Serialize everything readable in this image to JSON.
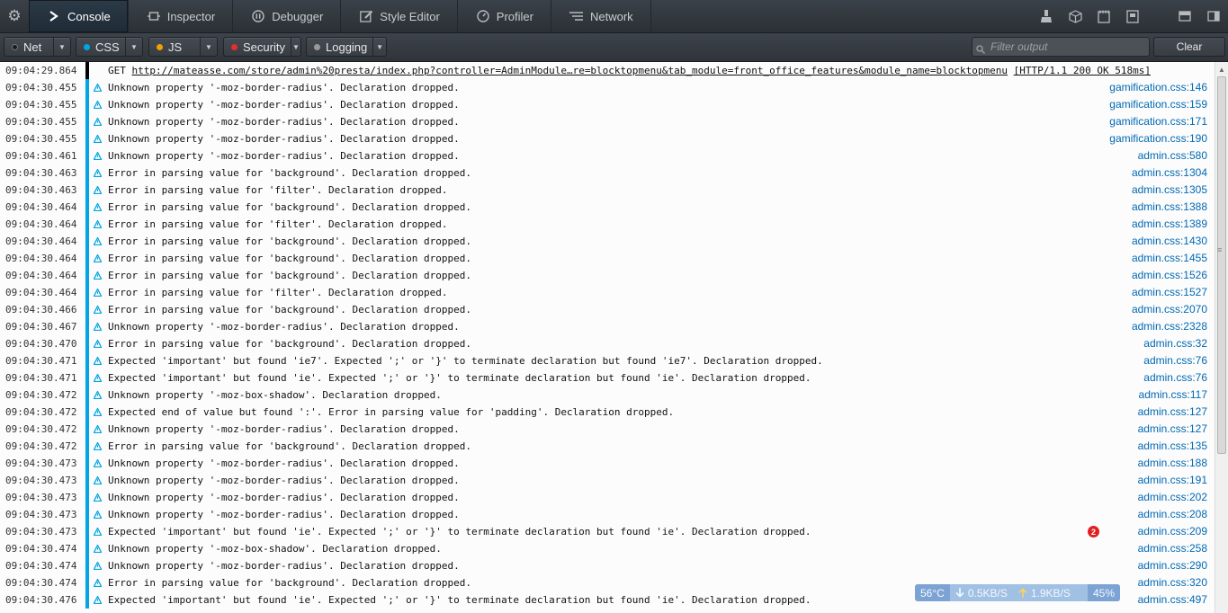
{
  "tabs": [
    {
      "label": "Console",
      "icon": "console-prompt-icon",
      "active": true
    },
    {
      "label": "Inspector",
      "icon": "inspector-icon",
      "active": false
    },
    {
      "label": "Debugger",
      "icon": "debugger-pause-icon",
      "active": false
    },
    {
      "label": "Style Editor",
      "icon": "pencil-icon",
      "active": false
    },
    {
      "label": "Profiler",
      "icon": "stopwatch-icon",
      "active": false
    },
    {
      "label": "Network",
      "icon": "network-icon",
      "active": false
    }
  ],
  "filters": [
    {
      "label": "Net",
      "color": "#1a1a1a"
    },
    {
      "label": "CSS",
      "color": "#00a6e3"
    },
    {
      "label": "JS",
      "color": "#f2a000"
    },
    {
      "label": "Security",
      "color": "#e03030"
    },
    {
      "label": "Logging",
      "color": "#999999"
    }
  ],
  "filter_output": {
    "placeholder": "Filter output",
    "value": ""
  },
  "clear_label": "Clear",
  "log": {
    "net_entry": {
      "time": "09:04:29.864",
      "method": "GET",
      "url": "http://mateasse.com/store/admin%20presta/index.php?controller=AdminModule…re=blocktopmenu&tab_module=front_office_features&module_name=blocktopmenu",
      "status": "[HTTP/1.1 200 OK 518ms]"
    },
    "entries": [
      {
        "time": "09:04:30.455",
        "msg": "Unknown property '-moz-border-radius'.  Declaration dropped.",
        "src": "gamification.css:146"
      },
      {
        "time": "09:04:30.455",
        "msg": "Unknown property '-moz-border-radius'.  Declaration dropped.",
        "src": "gamification.css:159"
      },
      {
        "time": "09:04:30.455",
        "msg": "Unknown property '-moz-border-radius'.  Declaration dropped.",
        "src": "gamification.css:171"
      },
      {
        "time": "09:04:30.455",
        "msg": "Unknown property '-moz-border-radius'.  Declaration dropped.",
        "src": "gamification.css:190"
      },
      {
        "time": "09:04:30.461",
        "msg": "Unknown property '-moz-border-radius'.  Declaration dropped.",
        "src": "admin.css:580"
      },
      {
        "time": "09:04:30.463",
        "msg": "Error in parsing value for 'background'.  Declaration dropped.",
        "src": "admin.css:1304"
      },
      {
        "time": "09:04:30.463",
        "msg": "Error in parsing value for 'filter'.  Declaration dropped.",
        "src": "admin.css:1305"
      },
      {
        "time": "09:04:30.464",
        "msg": "Error in parsing value for 'background'.  Declaration dropped.",
        "src": "admin.css:1388"
      },
      {
        "time": "09:04:30.464",
        "msg": "Error in parsing value for 'filter'.  Declaration dropped.",
        "src": "admin.css:1389"
      },
      {
        "time": "09:04:30.464",
        "msg": "Error in parsing value for 'background'.  Declaration dropped.",
        "src": "admin.css:1430"
      },
      {
        "time": "09:04:30.464",
        "msg": "Error in parsing value for 'background'.  Declaration dropped.",
        "src": "admin.css:1455"
      },
      {
        "time": "09:04:30.464",
        "msg": "Error in parsing value for 'background'.  Declaration dropped.",
        "src": "admin.css:1526"
      },
      {
        "time": "09:04:30.464",
        "msg": "Error in parsing value for 'filter'.  Declaration dropped.",
        "src": "admin.css:1527"
      },
      {
        "time": "09:04:30.466",
        "msg": "Error in parsing value for 'background'.  Declaration dropped.",
        "src": "admin.css:2070"
      },
      {
        "time": "09:04:30.467",
        "msg": "Unknown property '-moz-border-radius'.  Declaration dropped.",
        "src": "admin.css:2328"
      },
      {
        "time": "09:04:30.470",
        "msg": "Error in parsing value for 'background'.  Declaration dropped.",
        "src": "admin.css:32"
      },
      {
        "time": "09:04:30.471",
        "msg": "Expected 'important' but found 'ie7'.  Expected ';' or '}' to terminate declaration but found 'ie7'.  Declaration dropped.",
        "src": "admin.css:76"
      },
      {
        "time": "09:04:30.471",
        "msg": "Expected 'important' but found 'ie'.  Expected ';' or '}' to terminate declaration but found 'ie'.  Declaration dropped.",
        "src": "admin.css:76"
      },
      {
        "time": "09:04:30.472",
        "msg": "Unknown property '-moz-box-shadow'.  Declaration dropped.",
        "src": "admin.css:117"
      },
      {
        "time": "09:04:30.472",
        "msg": "Expected end of value but found ':'.  Error in parsing value for 'padding'.  Declaration dropped.",
        "src": "admin.css:127"
      },
      {
        "time": "09:04:30.472",
        "msg": "Unknown property '-moz-border-radius'.  Declaration dropped.",
        "src": "admin.css:127"
      },
      {
        "time": "09:04:30.472",
        "msg": "Error in parsing value for 'background'.  Declaration dropped.",
        "src": "admin.css:135"
      },
      {
        "time": "09:04:30.473",
        "msg": "Unknown property '-moz-border-radius'.  Declaration dropped.",
        "src": "admin.css:188"
      },
      {
        "time": "09:04:30.473",
        "msg": "Unknown property '-moz-border-radius'.  Declaration dropped.",
        "src": "admin.css:191"
      },
      {
        "time": "09:04:30.473",
        "msg": "Unknown property '-moz-border-radius'.  Declaration dropped.",
        "src": "admin.css:202"
      },
      {
        "time": "09:04:30.473",
        "msg": "Unknown property '-moz-border-radius'.  Declaration dropped.",
        "src": "admin.css:208"
      },
      {
        "time": "09:04:30.473",
        "msg": "Expected 'important' but found 'ie'.  Expected ';' or '}' to terminate declaration but found 'ie'.  Declaration dropped.",
        "src": "admin.css:209"
      },
      {
        "time": "09:04:30.474",
        "msg": "Unknown property '-moz-box-shadow'.  Declaration dropped.",
        "src": "admin.css:258"
      },
      {
        "time": "09:04:30.474",
        "msg": "Unknown property '-moz-border-radius'.  Declaration dropped.",
        "src": "admin.css:290"
      },
      {
        "time": "09:04:30.474",
        "msg": "Error in parsing value for 'background'.  Declaration dropped.",
        "src": "admin.css:320"
      },
      {
        "time": "09:04:30.476",
        "msg": "Expected 'important' but found 'ie'.  Expected ';' or '}' to terminate declaration but found 'ie'.  Declaration dropped.",
        "src": "admin.css:497"
      }
    ]
  },
  "notification_badge": "2",
  "net_monitor": {
    "temperature": "56°C",
    "download": "0.5KB/S",
    "upload": "1.9KB/S",
    "usage": "45%"
  },
  "colors": {
    "css_bar": "#00a6e3",
    "net_bar": "#000000",
    "link": "#0069b4",
    "warning_icon": "#00a6e3"
  }
}
